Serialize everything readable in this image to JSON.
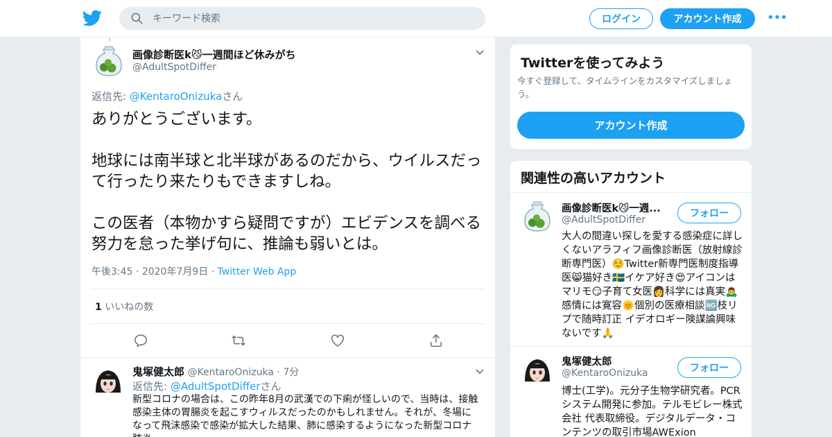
{
  "search": {
    "placeholder": "キーワード検索"
  },
  "header": {
    "login_label": "ログイン",
    "signup_label": "アカウント作成",
    "more_label": "•••"
  },
  "tweet": {
    "author_name": "画像診断医k😼一週間ほど休みがち",
    "author_handle": "@AdultSpotDiffer",
    "reply_prefix": "返信先: ",
    "reply_to": "@KentaroOnizuka",
    "reply_suffix": "さん",
    "paragraphs": [
      "ありがとうございます。",
      "地球には南半球と北半球があるのだから、ウイルスだって行ったり来たりもできますしね。",
      "この医者（本物かすら疑問ですが）エビデンスを調べる努力を怠った挙げ句に、推論も弱いとは。"
    ],
    "time": "午後3:45",
    "date": "2020年7月9日",
    "source": "Twitter Web App",
    "like_count": "1",
    "like_label": " いいねの数"
  },
  "reply": {
    "author_name": "鬼塚健太郎",
    "author_handle": "@KentaroOnizuka",
    "age": "7分",
    "reply_prefix": "返信先: ",
    "reply_to": "@AdultSpotDiffer",
    "reply_suffix": "さん",
    "text": "新型コロナの場合は、この昨年8月の武漢での下痢が怪しいので、当時は、接触感染主体の胃腸炎を起こすウィルスだったのかもしれません。それが、冬場になって飛沫感染で感染が拡大した結果、肺に感染するようになった新型コロナ肺炎"
  },
  "sidebar": {
    "try_card": {
      "title": "Twitterを使ってみよう",
      "subtitle": "今すぐ登録して、タイムラインをカスタマイズしましょう。",
      "signup_label": "アカウント作成"
    },
    "related": {
      "title": "関連性の高いアカウント",
      "follow_label": "フォロー",
      "accounts": [
        {
          "name": "画像診断医k😼一週...",
          "handle": "@AdultSpotDiffer",
          "bio": "大人の間違い探しを愛する感染症に詳しくないアラフィフ画像診断医（放射線診断専門医）☺️Twitter新専門医制度指導医😸猫好き🇸🇪イケア好き😍アイコンはマリモ😏子育て女医👩科学には真実🙇‍♂️感情には寛容🌞個別の医療相談🆖枝リプで随時訂正 イデオロギー険謀論興味ないです🙏"
        },
        {
          "name": "鬼塚健太郎",
          "handle": "@KentaroOnizuka",
          "bio": "博士(工学)。元分子生物学研究者。PCRシステム開発に参加。テルモビレー株式会社 代表取締役。デジタルデータ・コンテンツの取引市場AWExion"
        }
      ]
    }
  },
  "icons": {
    "twitter": "twitter-bird-icon",
    "search": "search-icon",
    "reply": "reply-icon",
    "retweet": "retweet-icon",
    "like": "heart-icon",
    "share": "share-icon",
    "caret": "chevron-down-icon"
  },
  "colors": {
    "accent": "#1da1f2",
    "text": "#14171a",
    "muted": "#657786",
    "background": "#e6ecf0"
  }
}
